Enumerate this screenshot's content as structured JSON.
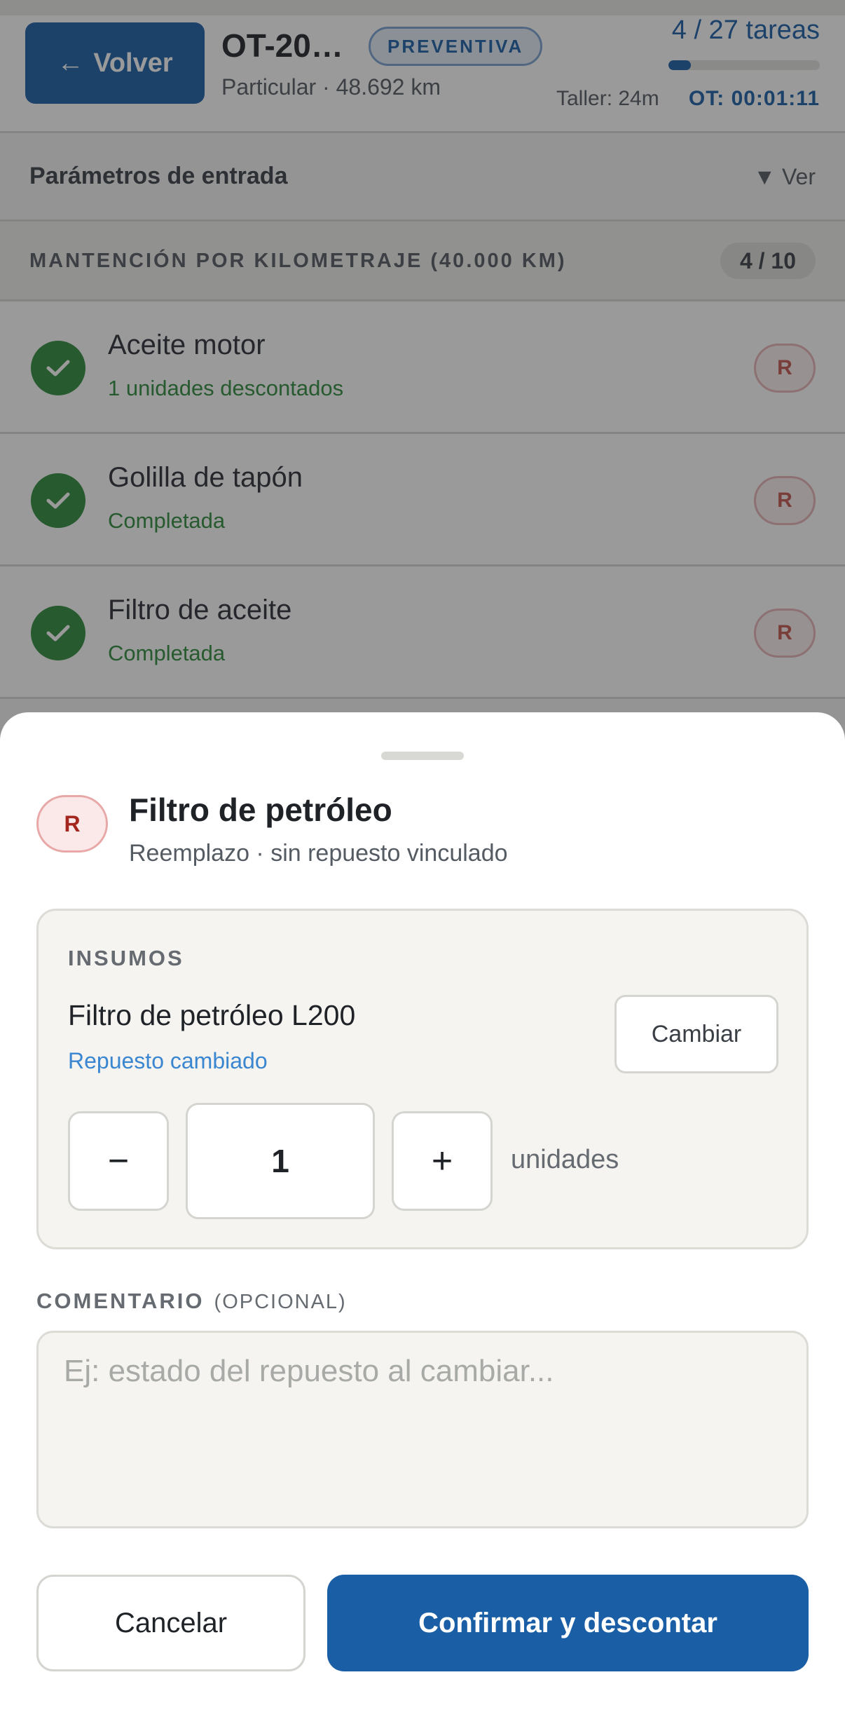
{
  "header": {
    "back_label": "Volver",
    "ot_title": "OT-20…",
    "ot_type_badge": "PREVENTIVA",
    "vehicle_info": "Particular · 48.692 km",
    "tasks_progress_text": "4 / 27 tareas",
    "tasks_done": 4,
    "tasks_total": 27,
    "timer_taller": "Taller: 24m",
    "timer_ot": "OT: 00:01:11"
  },
  "params": {
    "label": "Parámetros de entrada",
    "toggle_label": "▼ Ver"
  },
  "section": {
    "label": "MANTENCIÓN POR KILOMETRAJE (40.000 KM)",
    "count": "4 / 10"
  },
  "tasks": [
    {
      "name": "Aceite motor",
      "status": "1 unidades descontados",
      "badge": "R"
    },
    {
      "name": "Golilla de tapón",
      "status": "Completada",
      "badge": "R"
    },
    {
      "name": "Filtro de aceite",
      "status": "Completada",
      "badge": "R"
    }
  ],
  "sheet": {
    "badge": "R",
    "title": "Filtro de petróleo",
    "subtitle": "Reemplazo · sin repuesto vinculado",
    "insumos_label": "INSUMOS",
    "part_name": "Filtro de petróleo L200",
    "part_link": "Repuesto cambiado",
    "change_label": "Cambiar",
    "qty_minus": "−",
    "qty_value": "1",
    "qty_plus": "+",
    "qty_unit": "unidades",
    "comment_label": "COMENTARIO",
    "comment_optional": "(OPCIONAL)",
    "comment_value": "",
    "comment_placeholder": "Ej: estado del repuesto al cambiar...",
    "cancel_label": "Cancelar",
    "confirm_label": "Confirmar y descontar"
  },
  "colors": {
    "primary": "#1a5fa6",
    "success": "#2e8b3a",
    "replace_badge": "#a3271f",
    "link": "#3a86d0"
  },
  "icons": {
    "back": "arrow-left-icon",
    "task_done": "check-icon"
  }
}
